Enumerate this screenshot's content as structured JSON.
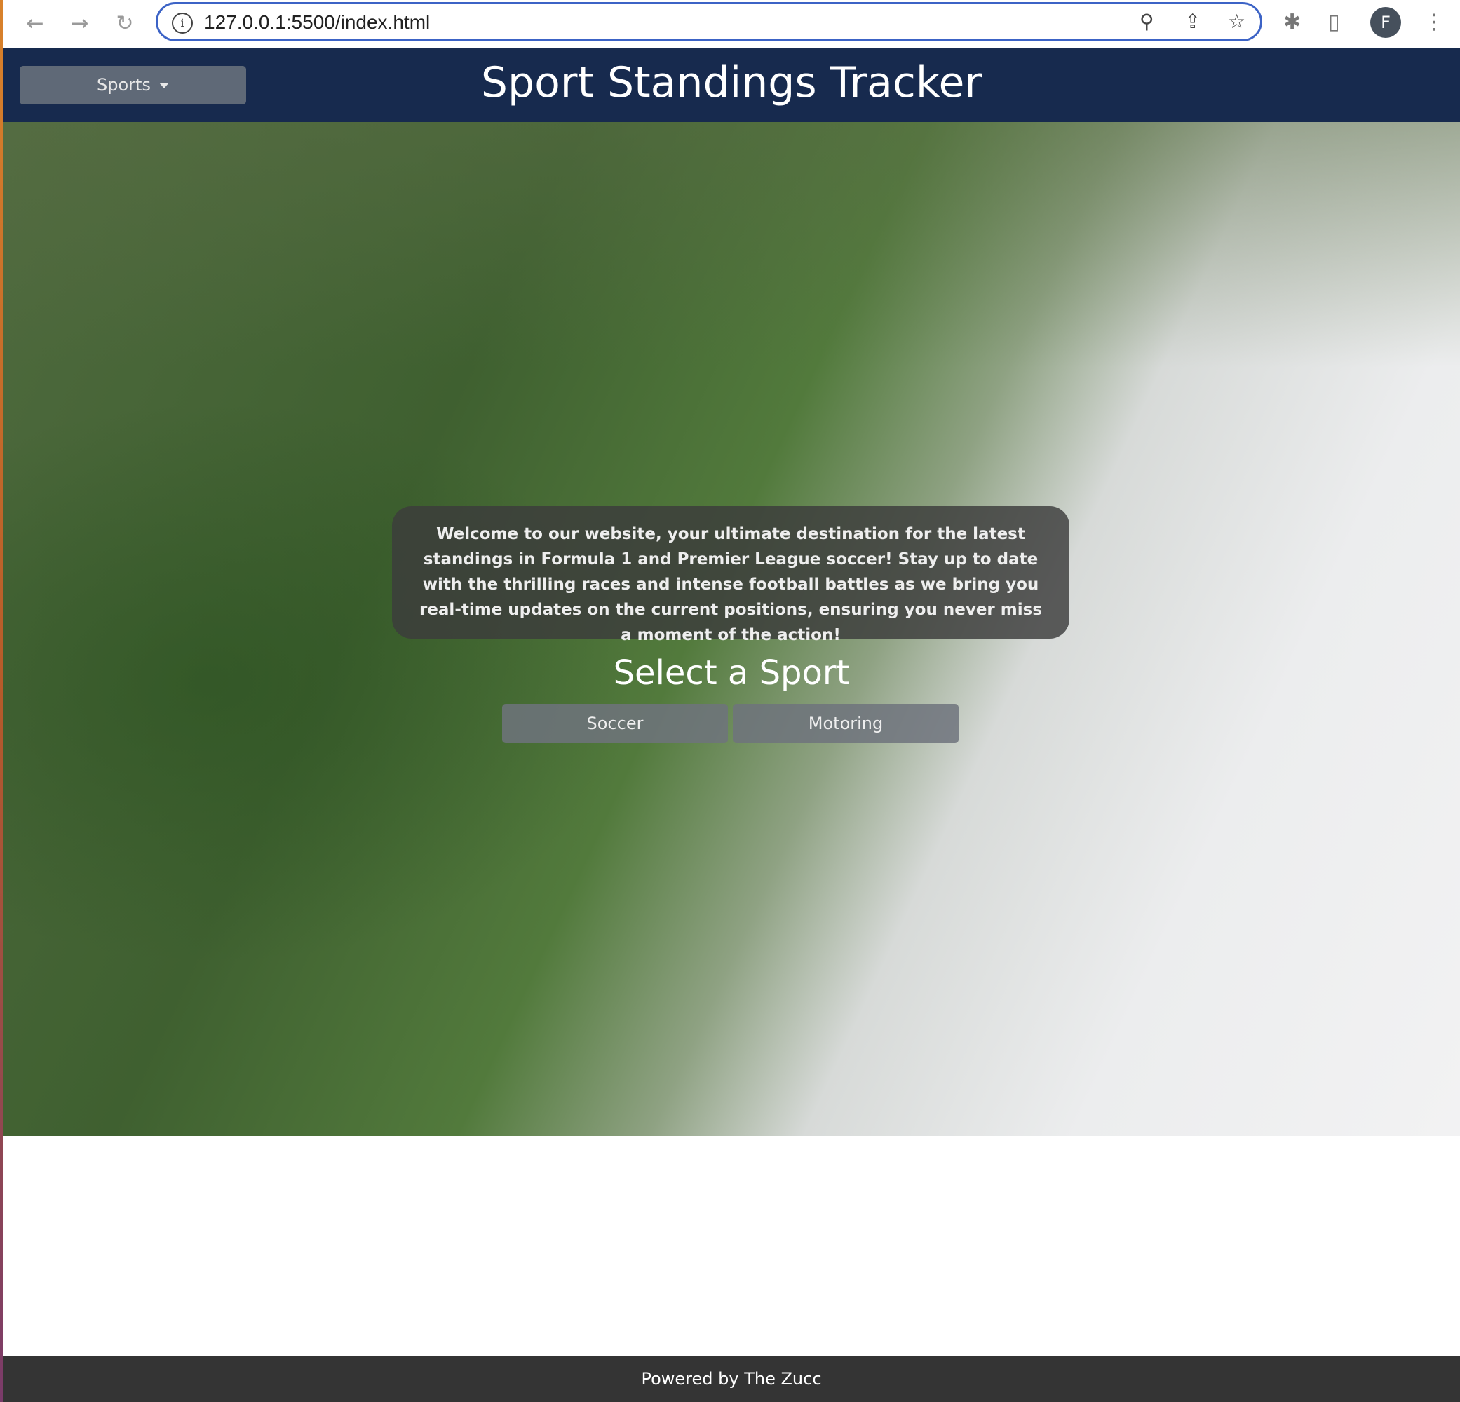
{
  "browser": {
    "url": "127.0.0.1:5500/index.html",
    "profile_initial": "F"
  },
  "navbar": {
    "dropdown_label": "Sports",
    "title": "Sport Standings Tracker"
  },
  "main": {
    "welcome_text": "Welcome to our website, your ultimate destination for the latest standings in Formula 1 and Premier League soccer! Stay up to date with the thrilling races and intense football battles as we bring you real-time updates on the current positions, ensuring you never miss a moment of the action!",
    "select_heading": "Select a Sport",
    "buttons": [
      {
        "label": "Soccer"
      },
      {
        "label": "Motoring"
      }
    ]
  },
  "footer": {
    "text": "Powered by The Zucc"
  },
  "colors": {
    "navbar": "#172a4e",
    "footer": "#343434",
    "button": "#5f6977"
  }
}
